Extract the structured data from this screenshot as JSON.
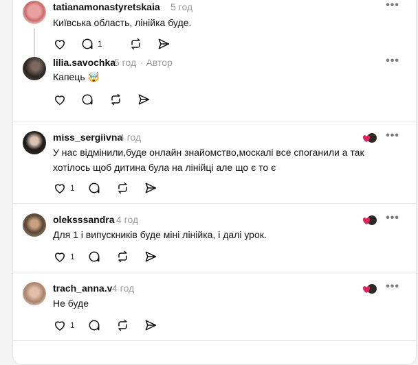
{
  "comments": [
    {
      "username": "tatianamonastyretskaia",
      "time": "5 год",
      "text": "Київська область, лінійка буде.",
      "replies": "1"
    },
    {
      "username": "lilia.savochka",
      "time": "5 год",
      "author_tag": "· Автор",
      "text": "Капець 🤯"
    },
    {
      "username": "miss_sergiivna",
      "time": "4 год",
      "text": "У нас відмінили,буде онлайн знайомство,москалі все споганили а так хотілось щоб дитина була на лінійці але що є то є",
      "likes": "1"
    },
    {
      "username": "oleksssandra",
      "time": "4 год",
      "text": "Для 1 і випускників буде міні лінійка, і далі урок.",
      "likes": "1"
    },
    {
      "username": "trach_anna.v",
      "time": "4 год",
      "text": "Не буде",
      "likes": "1"
    }
  ],
  "icons": {
    "like": "heart-icon",
    "reply": "speech-bubble-icon",
    "repost": "repost-icon",
    "share": "send-icon",
    "more": "more-dots-icon",
    "liked_by_author": "liked-by-author-badge"
  },
  "colors": {
    "heart_red": "#e0245e",
    "muted_text": "#9a9a9a",
    "divider": "#e6e6e6"
  },
  "more_label": "•••"
}
